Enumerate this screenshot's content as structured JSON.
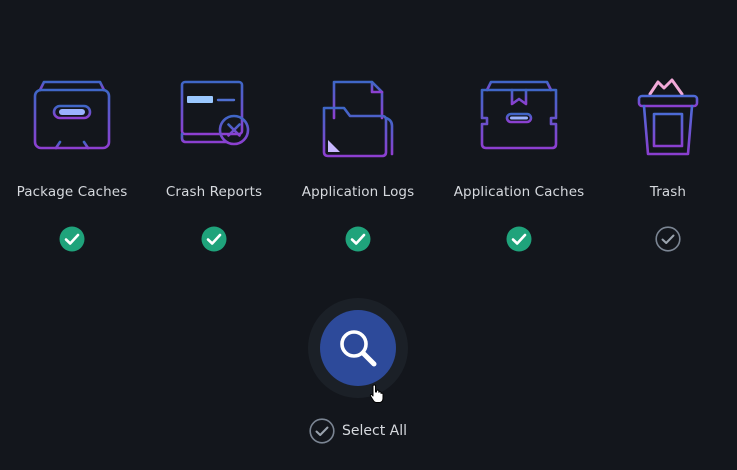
{
  "categories": [
    {
      "label": "Package Caches",
      "checked": true,
      "icon": "package-box-icon"
    },
    {
      "label": "Crash Reports",
      "checked": true,
      "icon": "crash-report-icon"
    },
    {
      "label": "Application Logs",
      "checked": true,
      "icon": "folder-logs-icon"
    },
    {
      "label": "Application Caches",
      "checked": true,
      "icon": "app-cache-box-icon"
    },
    {
      "label": "Trash",
      "checked": false,
      "icon": "trash-basket-icon"
    }
  ],
  "scan": {
    "icon": "search-icon"
  },
  "select_all": {
    "label": "Select All",
    "checked": false
  },
  "colors": {
    "background": "#13161c",
    "check_active": "#1fa37b",
    "check_inactive_ring": "#7b8593",
    "scan_button": "#2d4a9a",
    "icon_gradient_top": "#3f67c7",
    "icon_gradient_bottom": "#8d3fd0"
  }
}
